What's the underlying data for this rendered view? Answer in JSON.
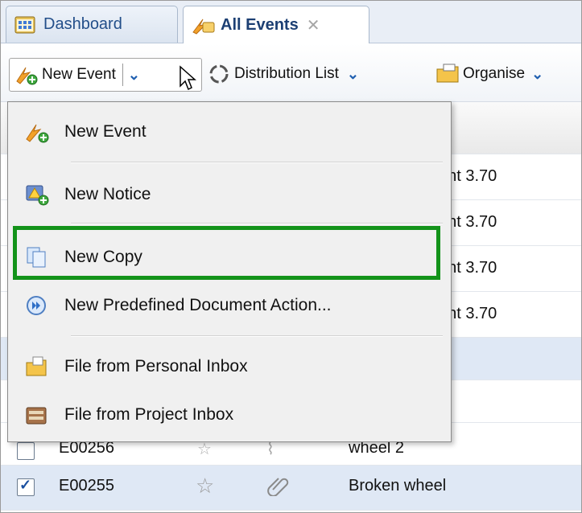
{
  "tabs": [
    {
      "label": "Dashboard",
      "icon": "dashboard-icon"
    },
    {
      "label": "All Events",
      "icon": "events-icon",
      "close": "✕"
    }
  ],
  "toolbar": {
    "new_event": "New Event",
    "distribution_list": "Distribution List",
    "organise": "Organise"
  },
  "menu": {
    "items": [
      {
        "label": "New Event",
        "icon": "new-event-icon"
      },
      {
        "label": "New Notice",
        "icon": "new-notice-icon"
      },
      {
        "label": "New Copy",
        "icon": "copy-icon"
      },
      {
        "label": "New Predefined Document Action...",
        "icon": "predefined-action-icon"
      },
      {
        "label": "File from Personal Inbox",
        "icon": "personal-inbox-icon"
      },
      {
        "label": "File from Project Inbox",
        "icon": "project-inbox-icon"
      }
    ]
  },
  "grid": {
    "partial_cells": [
      "ent 3.70",
      "ent 3.70",
      "ent 3.70",
      "ent 3.70"
    ],
    "rows": [
      {
        "id": "E00256",
        "title": "wheel 2",
        "checked": false
      },
      {
        "id": "E00255",
        "title": "Broken wheel",
        "checked": true
      }
    ]
  },
  "colors": {
    "highlight": "#13931a",
    "accent": "#1f5fb0"
  }
}
